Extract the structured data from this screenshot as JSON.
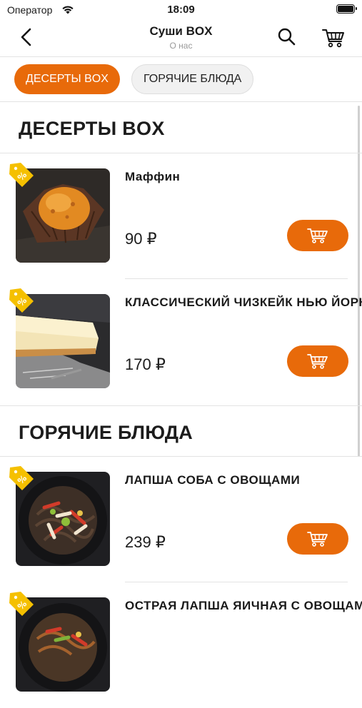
{
  "status_bar": {
    "carrier": "Оператор",
    "time": "18:09"
  },
  "nav": {
    "title": "Суши BOX",
    "subtitle": "О нас"
  },
  "tabs": [
    {
      "label": "ДЕСЕРТЫ BOX",
      "active": true
    },
    {
      "label": "ГОРЯЧИЕ БЛЮДА",
      "active": false
    }
  ],
  "sections": [
    {
      "title": "ДЕСЕРТЫ BOX",
      "items": [
        {
          "name": "Маффин",
          "price": "90 ₽",
          "image": "muffin"
        },
        {
          "name": "КЛАССИЧЕСКИЙ ЧИЗКЕЙК НЬЮ ЙОРК",
          "price": "170 ₽",
          "image": "cheesecake"
        }
      ]
    },
    {
      "title": "ГОРЯЧИЕ БЛЮДА",
      "items": [
        {
          "name": "ЛАПША СОБА С ОВОЩАМИ",
          "price": "239 ₽",
          "image": "soba-noodles"
        },
        {
          "name": "ОСТРАЯ ЛАПША ЯИЧНАЯ С ОВОЩАМИ",
          "price": "",
          "image": "egg-noodles"
        }
      ]
    }
  ],
  "colors": {
    "accent": "#e86a0a",
    "promo_tag": "#f5c000",
    "divider": "#e3e3e3"
  },
  "icons": [
    "wifi-icon",
    "battery-icon",
    "back-arrow-icon",
    "search-icon",
    "cart-icon",
    "discount-tag-icon",
    "add-to-cart-icon"
  ]
}
